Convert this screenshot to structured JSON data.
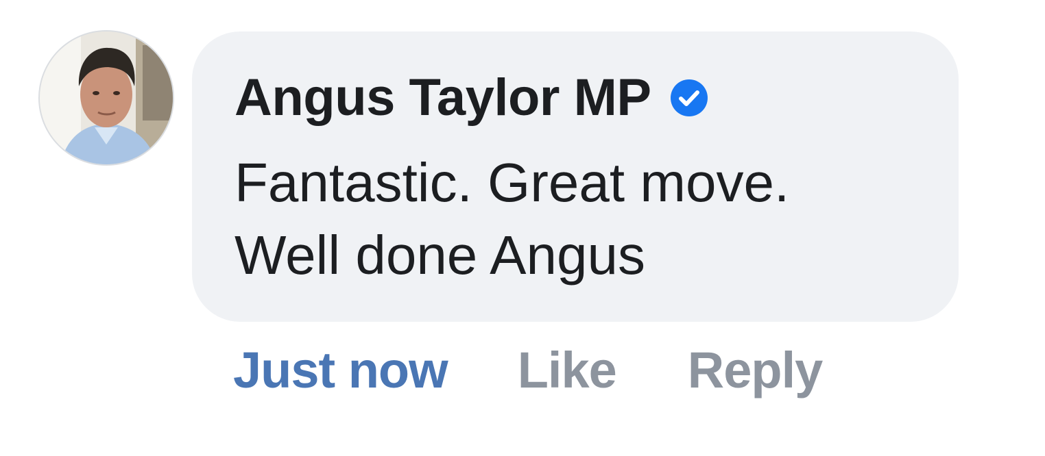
{
  "comment": {
    "author": "Angus Taylor MP",
    "verified": true,
    "text_lines": [
      "Fantastic. Great move.",
      "Well done Angus"
    ],
    "timestamp": "Just now",
    "like_label": "Like",
    "reply_label": "Reply"
  },
  "icons": {
    "avatar": "profile-photo-icon",
    "verified": "verified-badge-icon"
  },
  "colors": {
    "bubble": "#f0f2f5",
    "author": "#1c1e21",
    "text": "#1c1e21",
    "timestamp": "#4a76b4",
    "actions": "#8d949e",
    "verified_badge": "#1877f2"
  }
}
